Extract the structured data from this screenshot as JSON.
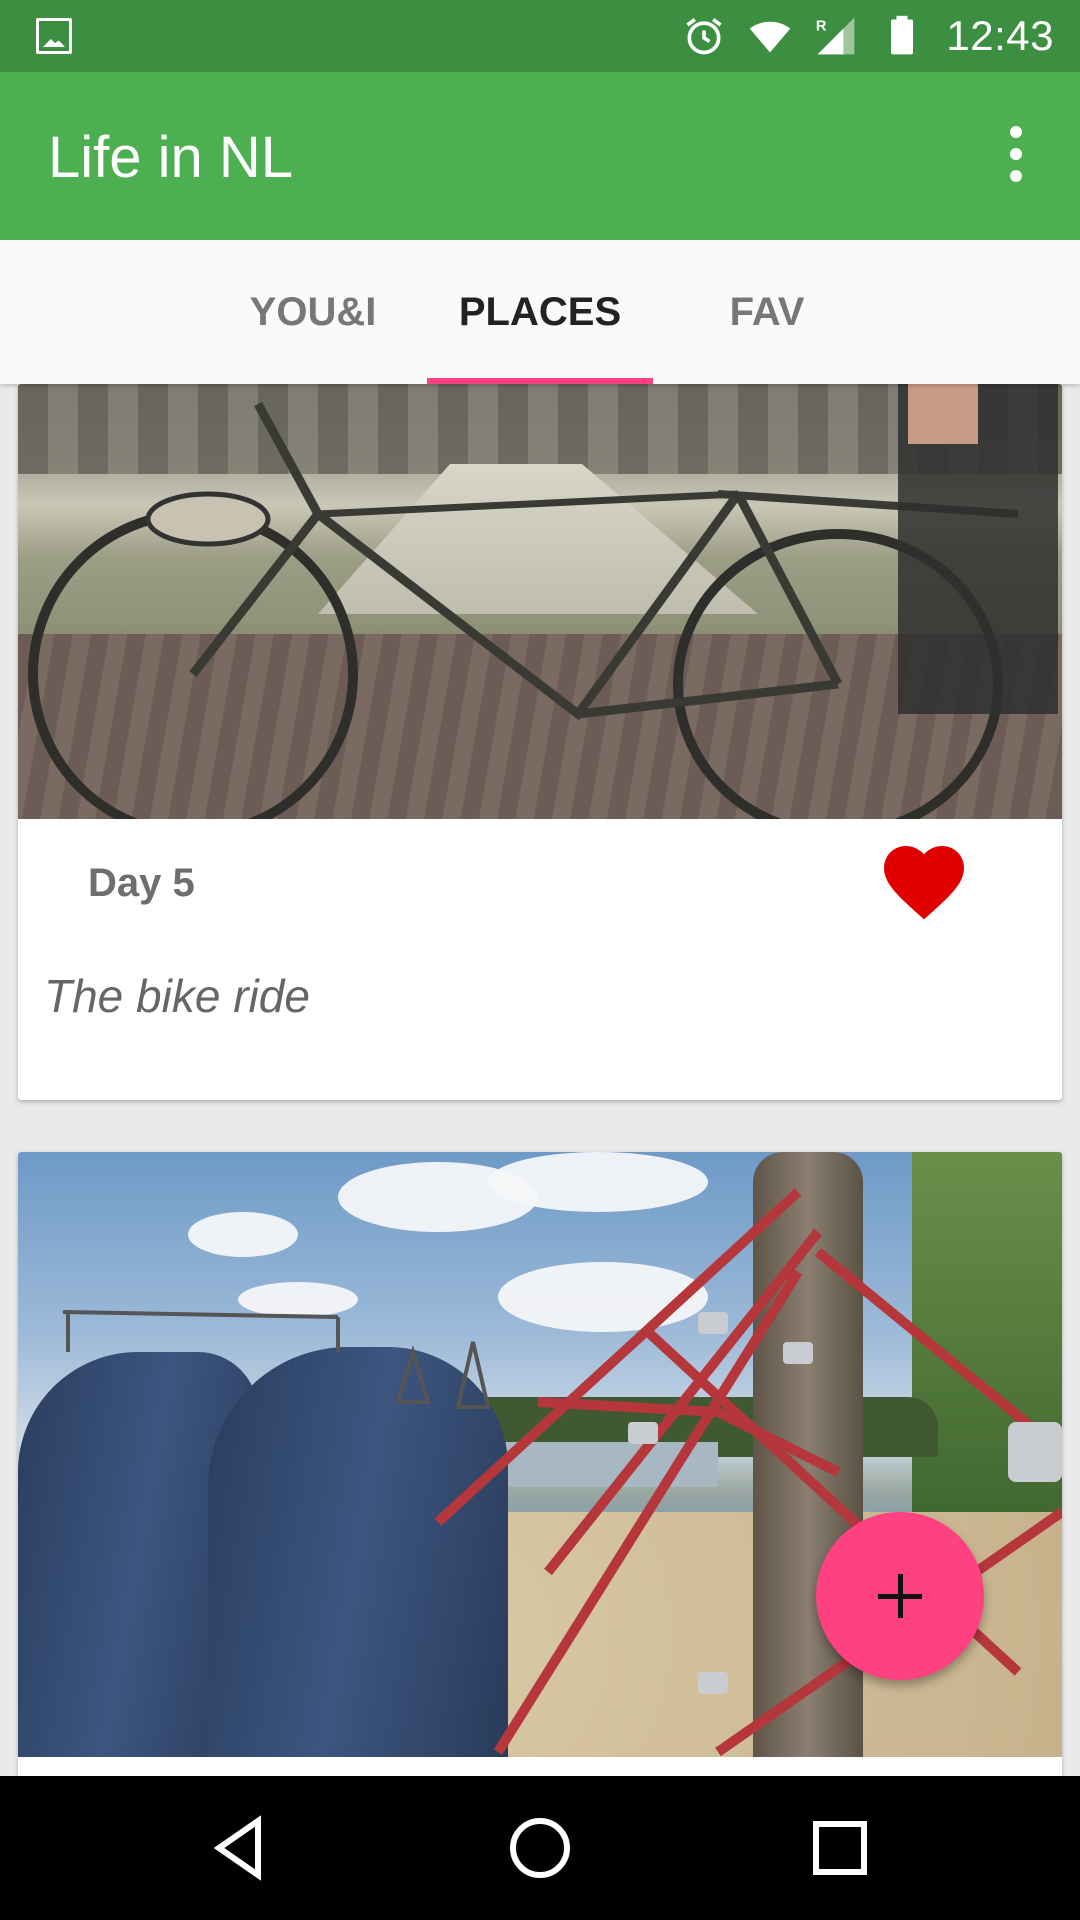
{
  "status_bar": {
    "time": "12:43",
    "icons": [
      "image-icon",
      "alarm-icon",
      "wifi-icon",
      "signal-roaming-icon",
      "battery-icon"
    ]
  },
  "app_bar": {
    "title": "Life in NL",
    "menu_icon": "more-vert-icon",
    "background": "#4caf50"
  },
  "tabs": [
    {
      "label": "YOU&I",
      "active": false
    },
    {
      "label": "PLACES",
      "active": true
    },
    {
      "label": "FAV",
      "active": false
    }
  ],
  "accent_color": "#ff4081",
  "cards": [
    {
      "day": "Day 5",
      "title": "The bike ride",
      "favorite": true,
      "favorite_icon": "heart-icon",
      "heart_color": "#e00000"
    },
    {
      "day": "",
      "title": "",
      "favorite": false
    }
  ],
  "fab": {
    "icon": "plus-icon"
  },
  "nav_bar": {
    "icons": [
      "back-icon",
      "home-icon",
      "recents-icon"
    ]
  }
}
